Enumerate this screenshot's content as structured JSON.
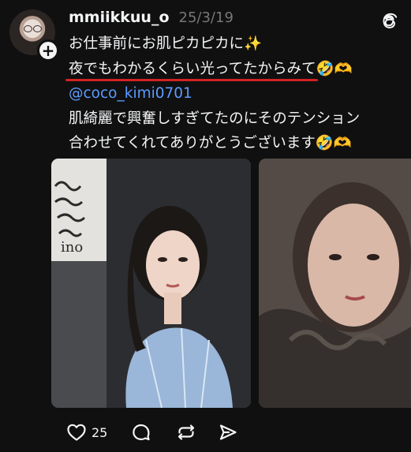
{
  "post": {
    "username": "mmiikkuu_o",
    "date": "25/3/19",
    "lines": [
      "お仕事前にお肌ピカピカに✨",
      "夜でもわかるくらい光ってたからみて",
      "🤣🫶",
      "@coco_kimi0701",
      "肌綺麗で興奮しすぎてたのにそのテンション",
      "合わせてくれてありがとうございます🤣🫶"
    ],
    "photo1_wall_text": "ino",
    "like_count": "25"
  },
  "icons": {
    "avatar": "avatar",
    "follow": "plus-icon",
    "app": "threads-logo-icon",
    "like": "heart-icon",
    "reply": "comment-bubble-icon",
    "repost": "repost-icon",
    "share": "send-icon"
  },
  "colors": {
    "background": "#101010",
    "text": "#f3f5f7",
    "muted": "#777777",
    "mention": "#5b9bff",
    "underline": "#d32222"
  }
}
